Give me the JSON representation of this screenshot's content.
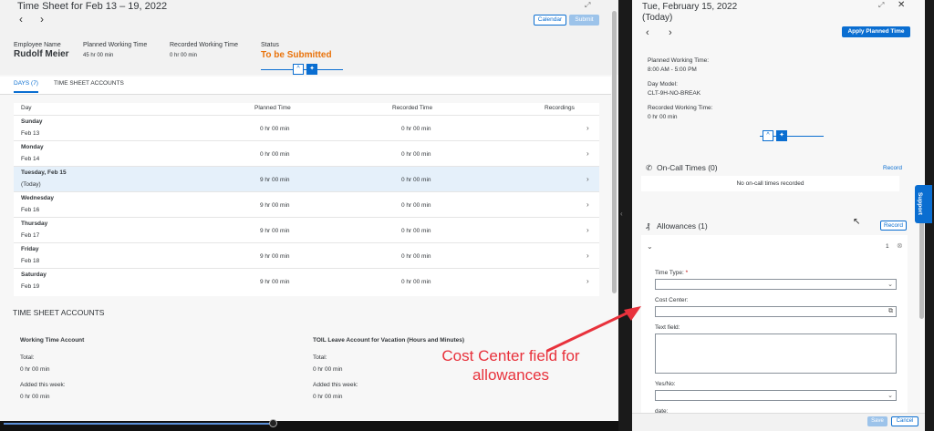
{
  "left": {
    "title": "Time Sheet for Feb 13 – 19, 2022",
    "calendar_label": "Calendar",
    "submit_label": "Submit",
    "employee_label": "Employee Name",
    "employee_name": "Rudolf Meier",
    "planned_label": "Planned Working Time",
    "planned_value": "45 hr 00 min",
    "recorded_label": "Recorded Working Time",
    "recorded_value": "0 hr 00 min",
    "status_label": "Status",
    "status_value": "To be Submitted",
    "tabs": [
      "DAYS (7)",
      "TIME SHEET ACCOUNTS"
    ],
    "table": {
      "headers": [
        "Day",
        "Planned Time",
        "Recorded Time",
        "Recordings"
      ],
      "rows": [
        {
          "day": "Sunday",
          "date": "Feb 13",
          "planned": "0 hr 00 min",
          "recorded": "0 hr 00 min"
        },
        {
          "day": "Monday",
          "date": "Feb 14",
          "planned": "0 hr 00 min",
          "recorded": "0 hr 00 min"
        },
        {
          "day": "Tuesday, Feb 15",
          "date": "(Today)",
          "planned": "9 hr 00 min",
          "recorded": "0 hr 00 min"
        },
        {
          "day": "Wednesday",
          "date": "Feb 16",
          "planned": "9 hr 00 min",
          "recorded": "0 hr 00 min"
        },
        {
          "day": "Thursday",
          "date": "Feb 17",
          "planned": "9 hr 00 min",
          "recorded": "0 hr 00 min"
        },
        {
          "day": "Friday",
          "date": "Feb 18",
          "planned": "9 hr 00 min",
          "recorded": "0 hr 00 min"
        },
        {
          "day": "Saturday",
          "date": "Feb 19",
          "planned": "9 hr 00 min",
          "recorded": "0 hr 00 min"
        }
      ]
    },
    "accounts": {
      "title": "TIME SHEET ACCOUNTS",
      "items": [
        {
          "name": "Working Time Account",
          "total_label": "Total:",
          "total": "0 hr 00 min",
          "added_label": "Added this week:",
          "added": "0 hr 00 min"
        },
        {
          "name": "TOIL Leave Account for Vacation (Hours and Minutes)",
          "total_label": "Total:",
          "total": "0 hr 00 min",
          "added_label": "Added this week:",
          "added": "0 hr 00 min"
        }
      ]
    }
  },
  "right": {
    "date": "Tue, February 15, 2022",
    "today": "(Today)",
    "apply_label": "Apply Planned Time",
    "planned_label": "Planned Working Time:",
    "planned_value": "8:00 AM - 5:00 PM",
    "day_model_label": "Day Model:",
    "day_model_value": "CLT-9H-NO-BREAK",
    "recorded_label": "Recorded Working Time:",
    "recorded_value": "0 hr 00 min",
    "oncall_title": "On-Call Times (0)",
    "oncall_record": "Record",
    "oncall_empty": "No on-call times recorded",
    "allow_title": "Allowances (1)",
    "allow_record": "Record",
    "allow_index": "1",
    "fields": {
      "time_type": "Time Type:",
      "cost_center": "Cost Center:",
      "text_field": "Text field:",
      "yes_no": "Yes/No:",
      "date": "date:"
    },
    "save_label": "Save",
    "cancel_label": "Cancel"
  },
  "support_label": "Support",
  "annotation": "Cost Center field for allowances",
  "colors": {
    "accent": "#0a6ed1",
    "status": "#e9730c",
    "annotation": "#e8323c"
  },
  "progress_fraction": 0.29
}
